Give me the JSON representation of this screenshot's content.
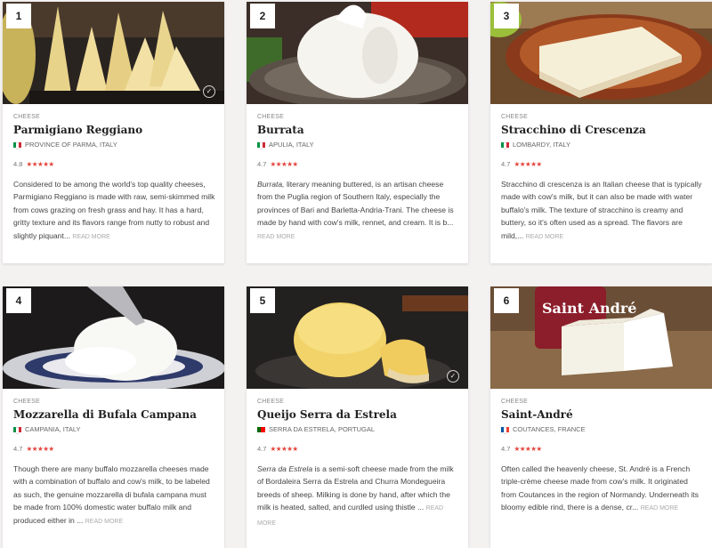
{
  "cards": [
    {
      "rank": "1",
      "category": "CHEESE",
      "title": "Parmigiano Reggiano",
      "flag": "italy",
      "origin": "PROVINCE OF PARMA, ITALY",
      "rating": "4.8",
      "stars": "★★★★★",
      "lead": "",
      "description": "Considered to be among the world's top quality cheeses, Parmigiano Reggiano is made with raw, semi-skimmed milk from cows grazing on fresh grass and hay. It has a hard, gritty texture and its flavors range from nutty to robust and slightly piquant... ",
      "read_more": "READ MORE"
    },
    {
      "rank": "2",
      "category": "CHEESE",
      "title": "Burrata",
      "flag": "italy",
      "origin": "APULIA, ITALY",
      "rating": "4.7",
      "stars": "★★★★★",
      "lead": "Burrata,",
      "description": " literary meaning buttered, is an artisan cheese from the Puglia region of Southern Italy, especially the provinces of Bari and Barletta-Andria-Trani. The cheese is made by hand with cow's milk, rennet, and cream. It is b... ",
      "read_more": "READ MORE"
    },
    {
      "rank": "3",
      "category": "CHEESE",
      "title": "Stracchino di Crescenza",
      "flag": "italy",
      "origin": "LOMBARDY, ITALY",
      "rating": "4.7",
      "stars": "★★★★★",
      "lead": "",
      "description": "Stracchino di crescenza is an Italian cheese that is typically made with cow's milk, but it can also be made with water buffalo's milk. The texture of stracchino is creamy and buttery, so it's often used as a spread. The flavors are mild,... ",
      "read_more": "READ MORE"
    },
    {
      "rank": "4",
      "category": "CHEESE",
      "title": "Mozzarella di Bufala Campana",
      "flag": "italy",
      "origin": "CAMPANIA, ITALY",
      "rating": "4.7",
      "stars": "★★★★★",
      "lead": "",
      "description": "Though there are many buffalo mozzarella cheeses made with a combination of buffalo and cow's milk, to be labeled as such, the genuine mozzarella di bufala campana must be made from 100% domestic water buffalo milk and produced either in ... ",
      "read_more": "READ MORE"
    },
    {
      "rank": "5",
      "category": "CHEESE",
      "title": "Queijo Serra da Estrela",
      "flag": "portugal",
      "origin": "SERRA DA ESTRELA, PORTUGAL",
      "rating": "4.7",
      "stars": "★★★★★",
      "lead": "Serra da Estrela",
      "description": " is a semi-soft cheese made from the milk of Bordaleira Serra da Estrela and Churra Mondegueira breeds of sheep. Milking is done by hand, after which the milk is heated, salted, and curdled using thistle ... ",
      "read_more": "READ MORE"
    },
    {
      "rank": "6",
      "category": "CHEESE",
      "title": "Saint-André",
      "flag": "france",
      "origin": "COUTANCES, FRANCE",
      "rating": "4.7",
      "stars": "★★★★★",
      "lead": "",
      "description": "Often called the heavenly cheese, St. André is a French triple-crème cheese made from cow's milk. It originated from Coutances in the region of Normandy. Underneath its bloomy edible rind, there is a dense, cr... ",
      "read_more": "READ MORE"
    }
  ],
  "package_label": "Saint André",
  "colors": {
    "accent_star": "#e4443c",
    "italy": [
      "#009246",
      "#ffffff",
      "#ce2b37"
    ],
    "portugal": [
      "#006600",
      "#ff0000",
      "#ff0000"
    ],
    "france": [
      "#0055a4",
      "#ffffff",
      "#ef4135"
    ]
  }
}
